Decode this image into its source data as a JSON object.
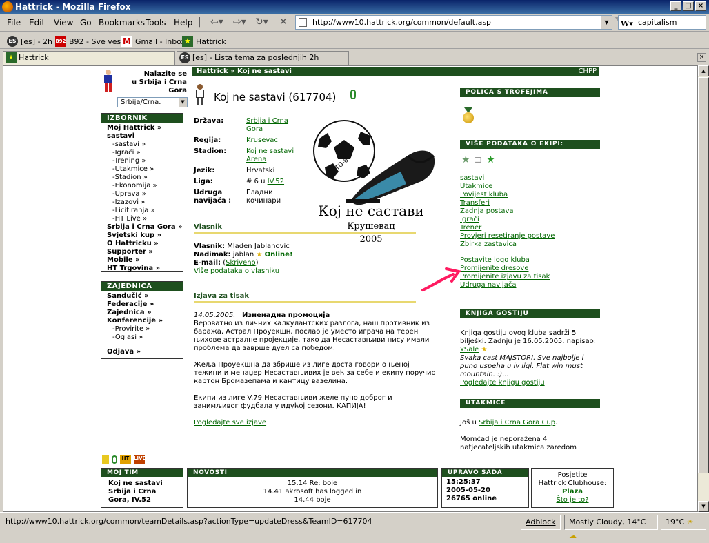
{
  "window": {
    "title": "Hattrick - Mozilla Firefox"
  },
  "menu": {
    "file": "File",
    "edit": "Edit",
    "view": "View",
    "go": "Go",
    "bookmarks": "Bookmarks",
    "tools": "Tools",
    "help": "Help"
  },
  "urlbar": {
    "value": "http://www10.hattrick.org/common/default.asp"
  },
  "search": {
    "value": "capitalism"
  },
  "bookmarks": [
    {
      "label": "[es] - 2h",
      "icon": "ES"
    },
    {
      "label": "B92 - Sve vesti",
      "icon": "B92"
    },
    {
      "label": "Gmail - Inbox",
      "icon": "M"
    },
    {
      "label": "Hattrick",
      "icon": "★"
    }
  ],
  "tabs": [
    {
      "label": "Hattrick",
      "icon": "★"
    },
    {
      "label": "[es] - Lista tema za poslednjih 2h",
      "icon": "ES"
    }
  ],
  "page": {
    "breadcrumb": "Hattrick » Koj ne sastavi",
    "chpp": "CHPP",
    "country_prompt": [
      "Nalazite se",
      "u Srbija i Crna",
      "Gora"
    ],
    "country_select": "Srbija/Crna.",
    "team_title": "Koj ne sastavi (617704)",
    "info": [
      {
        "label": "Država:",
        "value": "Srbija i Crna Gora",
        "link": true
      },
      {
        "label": "Regija:",
        "value": "Krusevac",
        "link": true
      },
      {
        "label": "Stadion:",
        "value": "Koj ne sastavi Arena",
        "link": true
      },
      {
        "label": "Jezik:",
        "value": "Hrvatski",
        "link": false
      },
      {
        "label": "Liga:",
        "value_prefix": "# 6 u ",
        "value": "IV.52",
        "link": true
      },
      {
        "label": "Udruga navijača :",
        "value": "Гладни кочинари",
        "link": false
      }
    ],
    "logo": {
      "title": "Кој не састави",
      "city": "Крушевац",
      "year": "2005",
      "ball_text": "TG-6"
    },
    "owner": {
      "header": "Vlasnik",
      "owner_label": "Vlasnik:",
      "owner_name": "Mladen Jablanovic",
      "nick_label": "Nadimak:",
      "nick": "jablan",
      "online": "Online!",
      "email_label": "E-mail:",
      "email_value": "Skriveno",
      "more": "Više podataka o vlasniku"
    },
    "statement": {
      "header": "Izjava za tisak",
      "date": "14.05.2005.",
      "title": "Изненадна промоција",
      "p1": "Вероватно из личних калкулантских разлога, наш противник из баража, Астрал Проуекшн, послао је уместо играча на терен њихове астралне пројекције, тако да Несаставњиви нису имали проблема да заврше дуел са победом.",
      "p2": "Жеља Проуекшна да збрише из лиге доста говори о њеној тежини и менаџер Несаставњивих је већ за себе и екипу поручио картон Бромазепама и кантицу вазелина.",
      "p3": "Екипи из лиге V.79 Несаставњиви желе пуно доброг и занимљивог фудбала у идућој сезони. КАПИЈА!",
      "see_all": "Pogledajte sve izjave"
    }
  },
  "left_menu": {
    "izbornik_header": "IZBORNIK",
    "izbornik": [
      {
        "label": "Moj Hattrick »",
        "bold": true
      },
      {
        "label": "sastavi",
        "bold": true
      },
      {
        "label": "-sastavi »",
        "bold": false
      },
      {
        "label": "-Igrači »",
        "bold": false
      },
      {
        "label": "-Trening »",
        "bold": false
      },
      {
        "label": "-Utakmice »",
        "bold": false
      },
      {
        "label": "-Stadion »",
        "bold": false
      },
      {
        "label": "-Ekonomija »",
        "bold": false
      },
      {
        "label": "-Uprava »",
        "bold": false
      },
      {
        "label": "-Izazovi »",
        "bold": false
      },
      {
        "label": "-Licitiranja »",
        "bold": false
      },
      {
        "label": "-HT Live »",
        "bold": false
      },
      {
        "label": "Srbija i Crna Gora »",
        "bold": true
      },
      {
        "label": "Svjetski kup »",
        "bold": true
      },
      {
        "label": "O Hattricku »",
        "bold": true
      },
      {
        "label": "Supporter »",
        "bold": true
      },
      {
        "label": "Mobile »",
        "bold": true
      },
      {
        "label": "HT Trgovina »",
        "bold": true
      }
    ],
    "zajednica_header": "ZAJEDNICA",
    "zajednica": [
      {
        "label": "Sandučić »",
        "bold": true
      },
      {
        "label": "Federacije »",
        "bold": true
      },
      {
        "label": "Zajednica »",
        "bold": true
      },
      {
        "label": "Konferencije »",
        "bold": true
      },
      {
        "label": "-Provirite »",
        "bold": false
      },
      {
        "label": "-Oglasi »",
        "bold": false
      }
    ],
    "odjava": "Odjava »"
  },
  "right": {
    "trophies_header": "POLICA S TROFEJIMA",
    "more_header": "VIŠE PODATAKA O EKIPI:",
    "links1": [
      "sastavi",
      "Utakmice",
      "Povijest kluba",
      "Transferi",
      "Zadnja postava",
      "Igrači",
      "Trener",
      "Provjeri resetiranje postave",
      "Zbirka zastavica"
    ],
    "links2": [
      "Postavite logo kluba",
      "Promijenite dresove",
      "Promijenite izjavu za tisak",
      "Udruga navijača"
    ],
    "guestbook_header": "KNJIGA GOSTIJU",
    "guestbook_text": "Knjiga gostiju ovog kluba sadrži 5 bilješki. Zadnju je 16.05.2005. napisao:",
    "guestbook_author": "xSale",
    "guestbook_quote": "Svaka cast MAJSTORI. Sve najbolje i puno uspeha u iv ligi. Flat win must mountain. :)...",
    "guestbook_link": "Pogledajte knjigu gostiju",
    "matches_header": "UTAKMICE",
    "matches_prefix": "Još u ",
    "matches_cup": "Srbija i Crna Gora Cup",
    "matches_unbeaten": "Momčad je neporažena 4 natjecateljskih utakmica zaredom"
  },
  "bottom": {
    "myteam_header": "MOJ TIM",
    "myteam_name": "Koj ne sastavi",
    "myteam_league": "Srbija i Crna Gora, IV.52",
    "news_header": "NOVOSTI",
    "news": [
      "15.14 Re: boje",
      "14.41 akrosoft has logged in",
      "14.44 boje"
    ],
    "now_header": "UPRAVO SADA",
    "now_time": "15:25:37",
    "now_date": "2005-05-20",
    "now_online": "26765 online",
    "clubhouse_line1": "Posjetite",
    "clubhouse_line2": "Hattrick Clubhouse:",
    "clubhouse_plaza": "Plaza",
    "clubhouse_what": "Što je to?"
  },
  "status": {
    "url": "http://www10.hattrick.org/common/teamDetails.asp?actionType=updateDress&TeamID=617704",
    "adblock": "Adblock",
    "weather": "Mostly Cloudy, 14°C",
    "temp": "19°C"
  },
  "colors": {
    "header_green": "#1e4f1e",
    "link_green": "#006600",
    "underline_yellow": "#e8d870"
  }
}
